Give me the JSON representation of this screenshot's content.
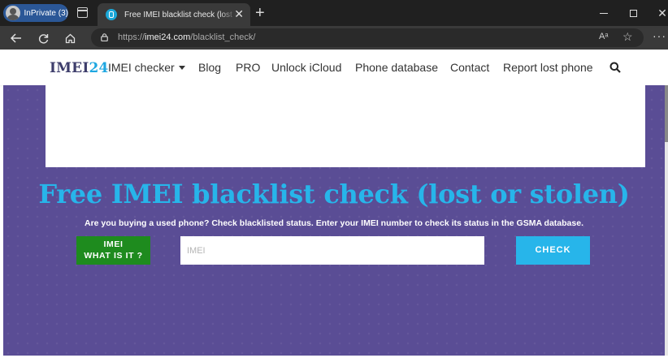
{
  "browser": {
    "inprivate_label": "InPrivate (3)",
    "tab_title": "Free IMEI blacklist check (lost or stolen)",
    "url_prefix": "https://",
    "url_host": "imei24.com",
    "url_path": "/blacklist_check/",
    "read_aloud_label": "Aᵃ"
  },
  "site": {
    "logo_text": "IMEI",
    "logo_num": "24",
    "nav": [
      {
        "label": "IMEI checker",
        "has_dropdown": true
      },
      {
        "label": "Blog"
      },
      {
        "label": "PRO"
      },
      {
        "label": "Unlock iCloud"
      },
      {
        "label": "Phone database"
      },
      {
        "label": "Contact"
      },
      {
        "label": "Report lost phone"
      }
    ]
  },
  "hero": {
    "title": "Free IMEI blacklist check (lost or stolen)",
    "subtitle": "Are you buying a used phone? Check blacklisted status. Enter your IMEI number to check its status in the GSMA database.",
    "what_button_line1": "IMEI",
    "what_button_line2": "WHAT IS IT ?",
    "input_placeholder": "IMEI",
    "input_value": "",
    "check_button": "CHECK"
  },
  "colors": {
    "hero_bg": "#5a4d95",
    "accent": "#27b5ea",
    "green_button": "#1e8b1e",
    "logo_dark": "#3d3d6b"
  },
  "icons": [
    "inprivate-avatar-icon",
    "tab-actions-icon",
    "favicon-icon",
    "close-icon",
    "plus-icon",
    "back-icon",
    "refresh-icon",
    "home-icon",
    "lock-icon",
    "read-aloud-icon",
    "star-icon",
    "more-icon",
    "search-icon",
    "caret-down-icon"
  ]
}
